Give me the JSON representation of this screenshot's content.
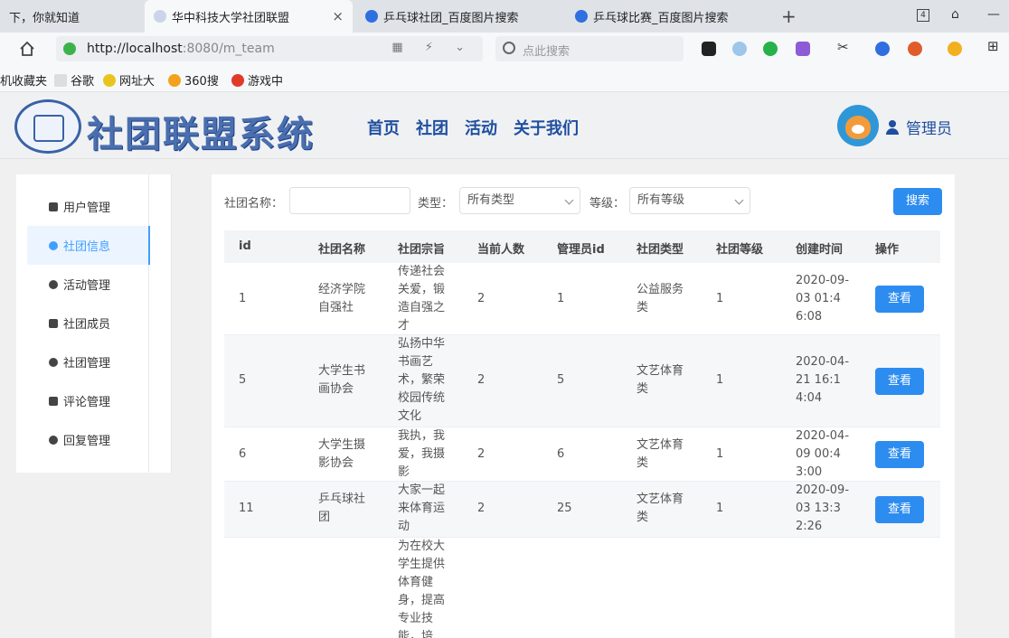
{
  "browser": {
    "tabs": [
      {
        "title": "下，你就知道"
      },
      {
        "title": "华中科技大学社团联盟"
      },
      {
        "title": "乒乓球社团_百度图片搜索"
      },
      {
        "title": "乒乓球比赛_百度图片搜索"
      }
    ],
    "tab_count": "4",
    "url_host": "http://localhost",
    "url_rest": ":8080/m_team",
    "search_placeholder": "点此搜索",
    "bookmarks": [
      "机收藏夹",
      "谷歌",
      "网址大",
      "360搜",
      "游戏中"
    ]
  },
  "header": {
    "system_title": "社团联盟系统",
    "nav": [
      "首页",
      "社团",
      "活动",
      "关于我们"
    ],
    "user_label": "管理员"
  },
  "sidebar": {
    "items": [
      {
        "label": "用户管理",
        "active": false
      },
      {
        "label": "社团信息",
        "active": true
      },
      {
        "label": "活动管理",
        "active": false
      },
      {
        "label": "社团成员",
        "active": false
      },
      {
        "label": "社团管理",
        "active": false
      },
      {
        "label": "评论管理",
        "active": false
      },
      {
        "label": "回复管理",
        "active": false
      }
    ]
  },
  "filters": {
    "name_label": "社团名称：",
    "name_value": "",
    "type_label": "类型：",
    "type_value": "所有类型",
    "level_label": "等级：",
    "level_value": "所有等级",
    "search_button": "搜索"
  },
  "table": {
    "columns": [
      "id",
      "社团名称",
      "社团宗旨",
      "当前人数",
      "管理员id",
      "社团类型",
      "社团等级",
      "创建时间",
      "操作"
    ],
    "rows": [
      {
        "id": "1",
        "name": "经济学院自强社",
        "purpose": "传递社会关爱，锻造自强之才",
        "members": "2",
        "admin_id": "1",
        "type": "公益服务类",
        "level": "1",
        "created": "2020-09-03 01:46:08",
        "action": "查看"
      },
      {
        "id": "5",
        "name": "大学生书画协会",
        "purpose": "弘扬中华书画艺术，繁荣校园传统文化",
        "members": "2",
        "admin_id": "5",
        "type": "文艺体育类",
        "level": "1",
        "created": "2020-04-21 16:14:04",
        "action": "查看"
      },
      {
        "id": "6",
        "name": "大学生摄影协会",
        "purpose": "我执，我爱，我摄影",
        "members": "2",
        "admin_id": "6",
        "type": "文艺体育类",
        "level": "1",
        "created": "2020-04-09 00:43:00",
        "action": "查看"
      },
      {
        "id": "11",
        "name": "乒乓球社团",
        "purpose": "大家一起来体育运动",
        "members": "2",
        "admin_id": "25",
        "type": "文艺体育类",
        "level": "1",
        "created": "2020-09-03 13:32:26",
        "action": "查看"
      },
      {
        "id": "",
        "name": "",
        "purpose": "为在校大学生提供体育健身，提高专业技能，培",
        "members": "",
        "admin_id": "",
        "type": "",
        "level": "",
        "created": "",
        "action": ""
      }
    ]
  }
}
